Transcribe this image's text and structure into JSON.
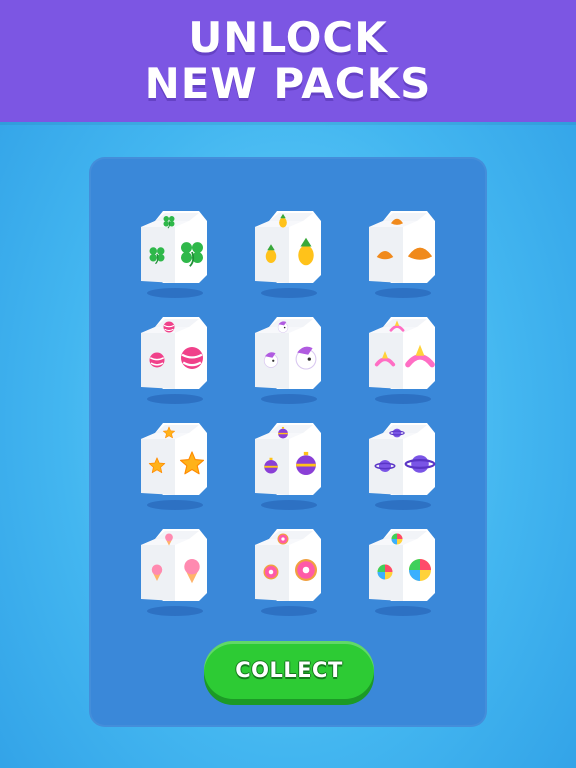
{
  "header": {
    "line1": "UNLOCK",
    "line2": "NEW PACKS"
  },
  "packs": [
    {
      "icon": "clover-icon",
      "color": "#2fb84a",
      "accent": "#1f8f36"
    },
    {
      "icon": "pineapple-icon",
      "color": "#ffc21a",
      "accent": "#39a83a"
    },
    {
      "icon": "croissant-icon",
      "color": "#f08a1c",
      "accent": "#d06a10"
    },
    {
      "icon": "candy-ball-icon",
      "color": "#f0418a",
      "accent": "#ffffff"
    },
    {
      "icon": "unicorn-icon",
      "color": "#ffffff",
      "accent": "#b05be0"
    },
    {
      "icon": "unicorn-horn-icon",
      "color": "#ff6ec4",
      "accent": "#ffd23a"
    },
    {
      "icon": "star-icon",
      "color": "#ffb21a",
      "accent": "#ff8a00"
    },
    {
      "icon": "ornament-ball-icon",
      "color": "#8a3fd6",
      "accent": "#ffc21a"
    },
    {
      "icon": "planet-icon",
      "color": "#7a55e6",
      "accent": "#5a35c6"
    },
    {
      "icon": "ice-cream-icon",
      "color": "#ffb46a",
      "accent": "#ff8ab0"
    },
    {
      "icon": "donut-icon",
      "color": "#ff5aa8",
      "accent": "#f0a040"
    },
    {
      "icon": "rainbow-lollipop-icon",
      "color": "#ff4a6a",
      "accent": "#3ab0ff"
    }
  ],
  "button": {
    "collect_label": "COLLECT"
  }
}
